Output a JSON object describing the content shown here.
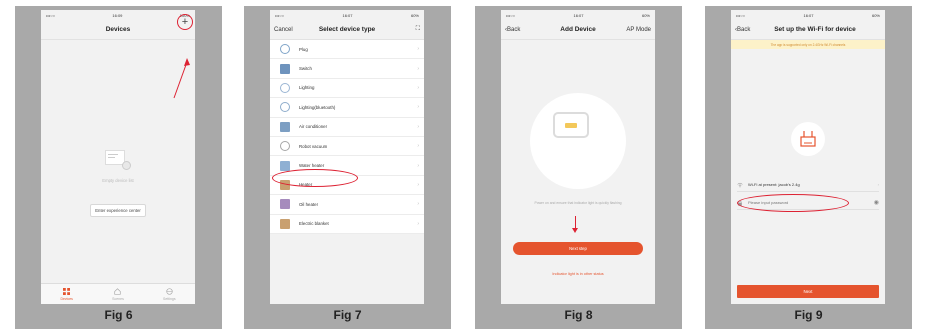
{
  "colors": {
    "accent": "#e5542e",
    "annotation": "#dd2233",
    "panel_bg": "#a9a9a9"
  },
  "fig6": {
    "label": "Fig 6",
    "status": {
      "carrier": "•••○○",
      "time": "16:09",
      "battery": "100%"
    },
    "title": "Devices",
    "add_icon": "plus-icon",
    "empty_text": "Empty device list",
    "experience_button": "Enter experience center",
    "tabs": [
      "Devices",
      "Scenes",
      "Settings"
    ]
  },
  "fig7": {
    "label": "Fig 7",
    "status": {
      "carrier": "•••○○",
      "time": "16:07",
      "battery": "60%"
    },
    "cancel": "Cancel",
    "title": "Select device type",
    "scan_icon": "scan-icon",
    "items": [
      {
        "label": "Plug",
        "icon": "plug-icon"
      },
      {
        "label": "Switch",
        "icon": "switch-icon"
      },
      {
        "label": "Lighting",
        "icon": "bulb-icon"
      },
      {
        "label": "Lighting(bluetooth)",
        "icon": "bulb-bluetooth-icon"
      },
      {
        "label": "Air conditioner",
        "icon": "air-conditioner-icon"
      },
      {
        "label": "Robot vacuum",
        "icon": "robot-vacuum-icon"
      },
      {
        "label": "Water heater",
        "icon": "water-heater-icon"
      },
      {
        "label": "Heater",
        "icon": "heater-icon"
      },
      {
        "label": "Oil heater",
        "icon": "oil-heater-icon"
      },
      {
        "label": "Electric blanket",
        "icon": "blanket-icon"
      }
    ]
  },
  "fig8": {
    "label": "Fig 8",
    "status": {
      "carrier": "•••○○",
      "time": "16:07",
      "battery": "60%"
    },
    "back": "Back",
    "title": "Add Device",
    "mode": "AP Mode",
    "instruction": "Power on and ensure that indicator light is quickly flashing",
    "next_step": "Next step",
    "other_status": "Indicator light is in other status"
  },
  "fig9": {
    "label": "Fig 9",
    "status": {
      "carrier": "•••○○",
      "time": "16:07",
      "battery": "60%"
    },
    "back": "Back",
    "title": "Set up the Wi-Fi for device",
    "banner": "The app is supported only on 2.4GHz Wi-Fi channels",
    "wifi_label": "Wi-Fi at present: jacob's 2.4g",
    "password_placeholder": "Please input password",
    "next": "Next"
  }
}
